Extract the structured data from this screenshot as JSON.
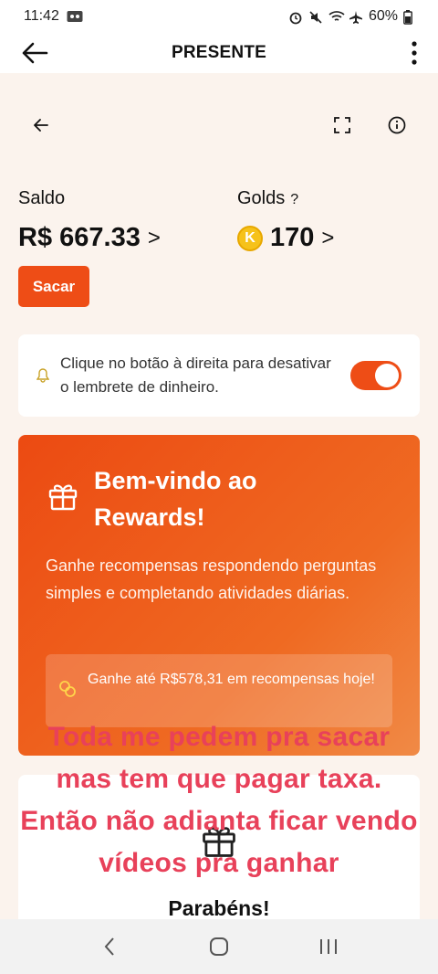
{
  "status_bar": {
    "time": "11:42",
    "battery": "60%"
  },
  "header": {
    "title": "PRESENTE"
  },
  "balance": {
    "label": "Saldo",
    "value": "R$ 667.33",
    "chevron": ">",
    "withdraw_label": "Sacar"
  },
  "golds": {
    "label": "Golds",
    "help": "?",
    "coin_letter": "K",
    "value": "170",
    "chevron": ">"
  },
  "reminder": {
    "text": "Clique no botão à direita para desativar o lembrete de dinheiro.",
    "toggle_on": true
  },
  "welcome": {
    "title": "Bem-vindo ao Rewards!",
    "description": "Ganhe recompensas respondendo perguntas simples e completando atividades diárias.",
    "offer": "Ganhe até R$578,31 em recompensas hoje!"
  },
  "congrats_card": {
    "title": "Parabéns!"
  },
  "overlay_caption": "Toda me pedem pra sacar mas tem que pagar taxa. Então não adianta ficar vendo vídeos pra ganhar",
  "colors": {
    "accent": "#ee4d16",
    "overlay_text": "#e8415a",
    "background": "#fbf3ed"
  }
}
